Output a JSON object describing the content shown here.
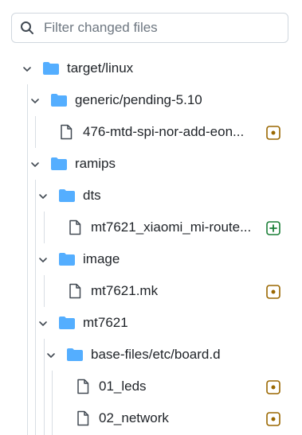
{
  "search": {
    "placeholder": "Filter changed files",
    "icon": "search-icon"
  },
  "tree": {
    "items": [
      {
        "type": "folder",
        "name": "target/linux",
        "expanded": true
      },
      {
        "type": "folder",
        "name": "generic/pending-5.10",
        "expanded": true
      },
      {
        "type": "file",
        "name": "476-mtd-spi-nor-add-eon...",
        "status": "modified"
      },
      {
        "type": "folder",
        "name": "ramips",
        "expanded": true
      },
      {
        "type": "folder",
        "name": "dts",
        "expanded": true
      },
      {
        "type": "file",
        "name": "mt7621_xiaomi_mi-route...",
        "status": "added"
      },
      {
        "type": "folder",
        "name": "image",
        "expanded": true
      },
      {
        "type": "file",
        "name": "mt7621.mk",
        "status": "modified"
      },
      {
        "type": "folder",
        "name": "mt7621",
        "expanded": true
      },
      {
        "type": "folder",
        "name": "base-files/etc/board.d",
        "expanded": true
      },
      {
        "type": "file",
        "name": "01_leds",
        "status": "modified"
      },
      {
        "type": "file",
        "name": "02_network",
        "status": "modified"
      }
    ]
  },
  "colors": {
    "folder": "#54aeff",
    "modified": "#9a6700",
    "added": "#1a7f37",
    "guide": "#d8dee4"
  }
}
